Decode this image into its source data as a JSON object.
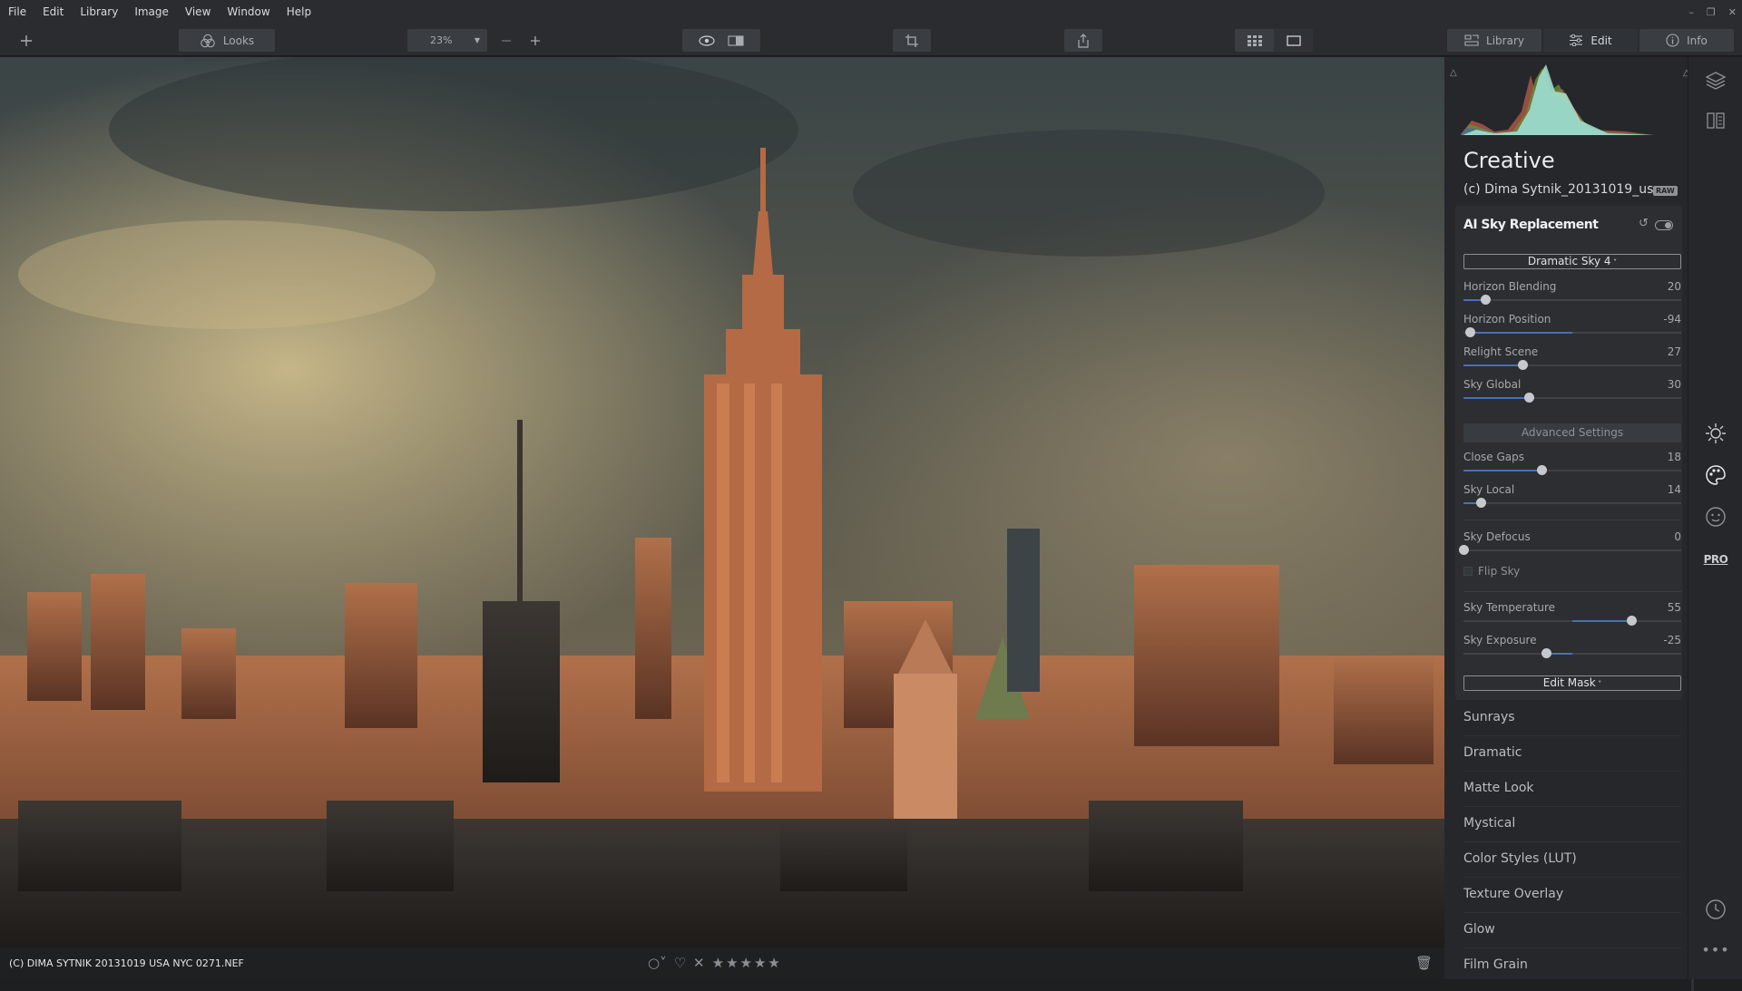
{
  "menu": [
    "File",
    "Edit",
    "Library",
    "Image",
    "View",
    "Window",
    "Help"
  ],
  "toolbar": {
    "add_icon": "plus-icon",
    "looks_label": "Looks",
    "zoom_value": "23%",
    "zoom_out_icon": "minus-icon",
    "zoom_in_icon": "plus-icon",
    "tabs": [
      {
        "label": "Library",
        "icon": "library-icon"
      },
      {
        "label": "Edit",
        "icon": "sliders-icon"
      },
      {
        "label": "Info",
        "icon": "info-icon"
      }
    ]
  },
  "panel": {
    "title": "Creative",
    "filename": "(c) Dima Sytnik_20131019_us...",
    "raw_badge": "RAW",
    "module": {
      "name": "AI Sky Replacement",
      "sky_dropdown": "Dramatic Sky 4",
      "sliders": [
        {
          "label": "Horizon Blending",
          "value": "20",
          "pos": 0.1
        },
        {
          "label": "Horizon Position",
          "value": "-94",
          "pos": 0.03
        },
        {
          "label": "Relight Scene",
          "value": "27",
          "pos": 0.27
        },
        {
          "label": "Sky Global",
          "value": "30",
          "pos": 0.3
        }
      ],
      "advanced_label": "Advanced Settings",
      "advanced_sliders": [
        {
          "label": "Close Gaps",
          "value": "18",
          "pos": 0.36
        },
        {
          "label": "Sky Local",
          "value": "14",
          "pos": 0.08
        },
        {
          "label": "Sky Defocus",
          "value": "0",
          "pos": 0.0
        }
      ],
      "flip_sky_label": "Flip Sky",
      "temp_sliders": [
        {
          "label": "Sky Temperature",
          "value": "55",
          "pos": 0.77
        },
        {
          "label": "Sky Exposure",
          "value": "-25",
          "pos": 0.38
        }
      ],
      "edit_mask_label": "Edit Mask"
    },
    "filters": [
      "Sunrays",
      "Dramatic",
      "Matte Look",
      "Mystical",
      "Color Styles (LUT)",
      "Texture Overlay",
      "Glow",
      "Film Grain"
    ]
  },
  "rail": {
    "icons": [
      "layers-icon",
      "compare-panel-icon",
      "sun-icon",
      "palette-icon",
      "face-icon",
      "pro-badge",
      "history-icon",
      "more-icon"
    ],
    "pro_label": "PRO"
  },
  "statusbar": {
    "filename": "(C) DIMA SYTNIK 20131019 USA NYC 0271.NEF",
    "rating_stars": 5
  },
  "colors": {
    "accent": "#4a6fb5",
    "panel_bg": "#25272a",
    "toolbar_bg": "#2a2c2f"
  }
}
